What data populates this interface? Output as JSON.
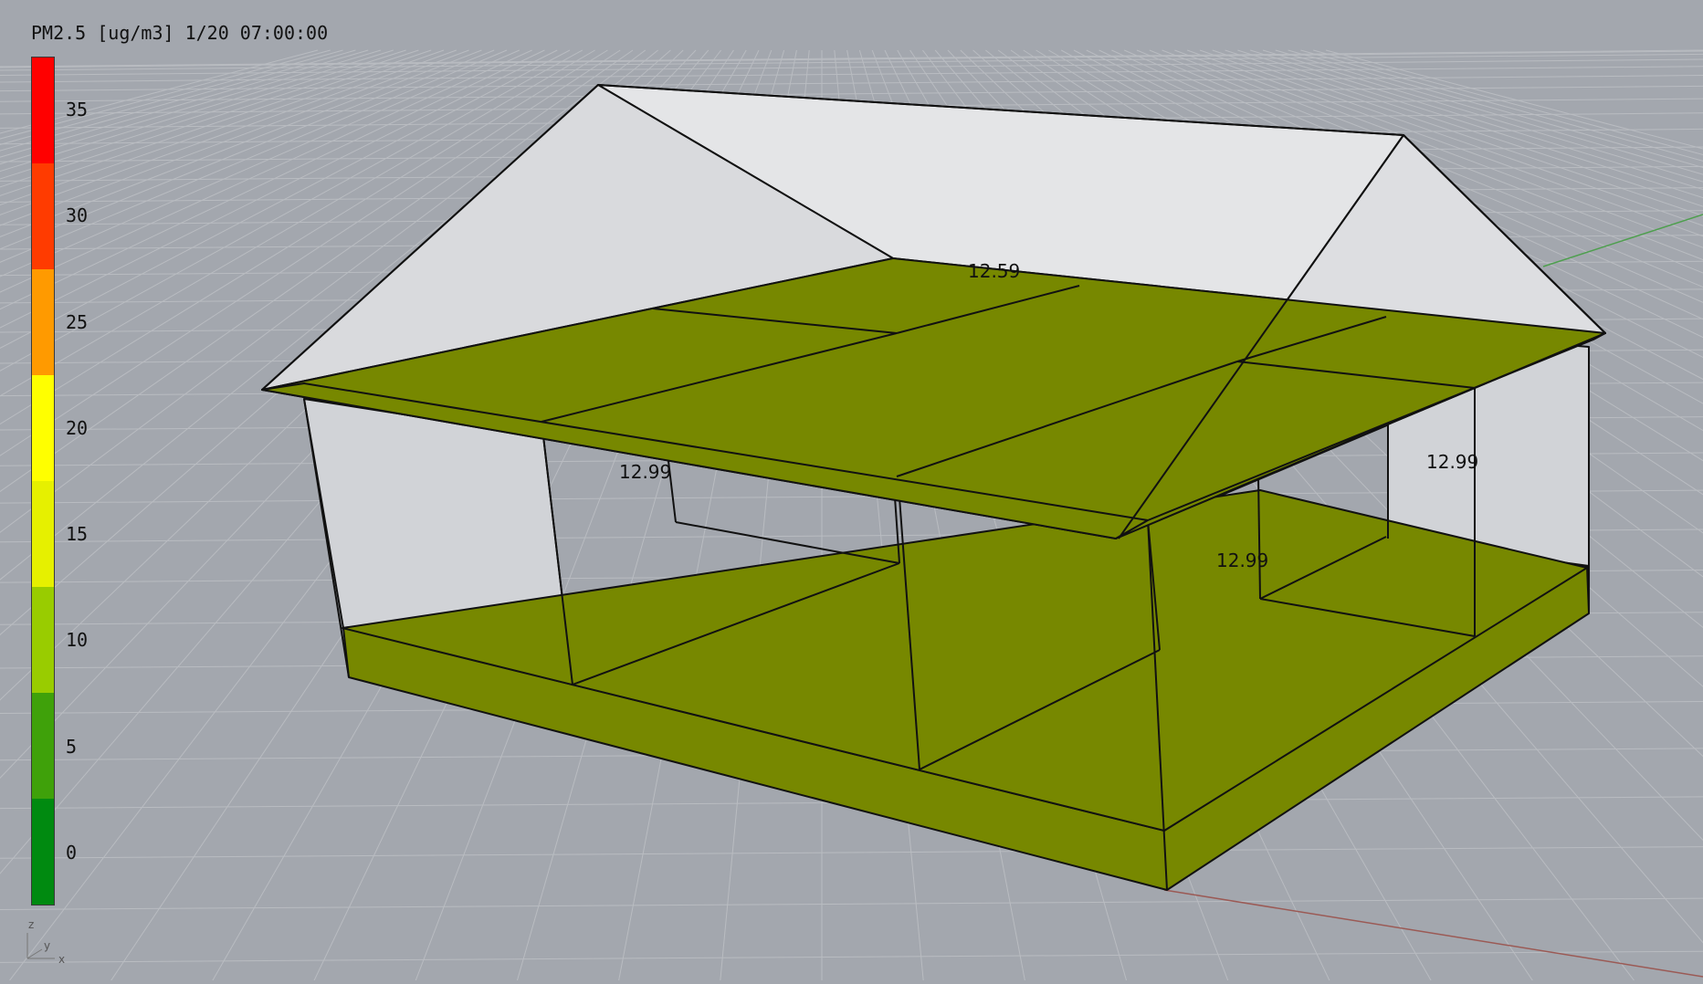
{
  "legend": {
    "title": "PM2.5 [ug/m3] 1/20 07:00:00",
    "labels": [
      "35",
      "30",
      "25",
      "20",
      "15",
      "10",
      "5",
      "0"
    ],
    "colors": [
      "#ff0000",
      "#ff3b00",
      "#ff9a00",
      "#ffff00",
      "#e6f000",
      "#99cc00",
      "#3fa10a",
      "#008a10"
    ]
  },
  "model": {
    "floor_color": "#778800",
    "wall_color": "#d6d8dc",
    "roof_color": "#e8e9eb",
    "values": {
      "upper_left_room": "12.99",
      "upper_center_room": "12.59",
      "lower_center_room": "12.99",
      "right_room": "12.99"
    }
  },
  "axes": {
    "z": "z",
    "y": "y",
    "x": "x"
  }
}
